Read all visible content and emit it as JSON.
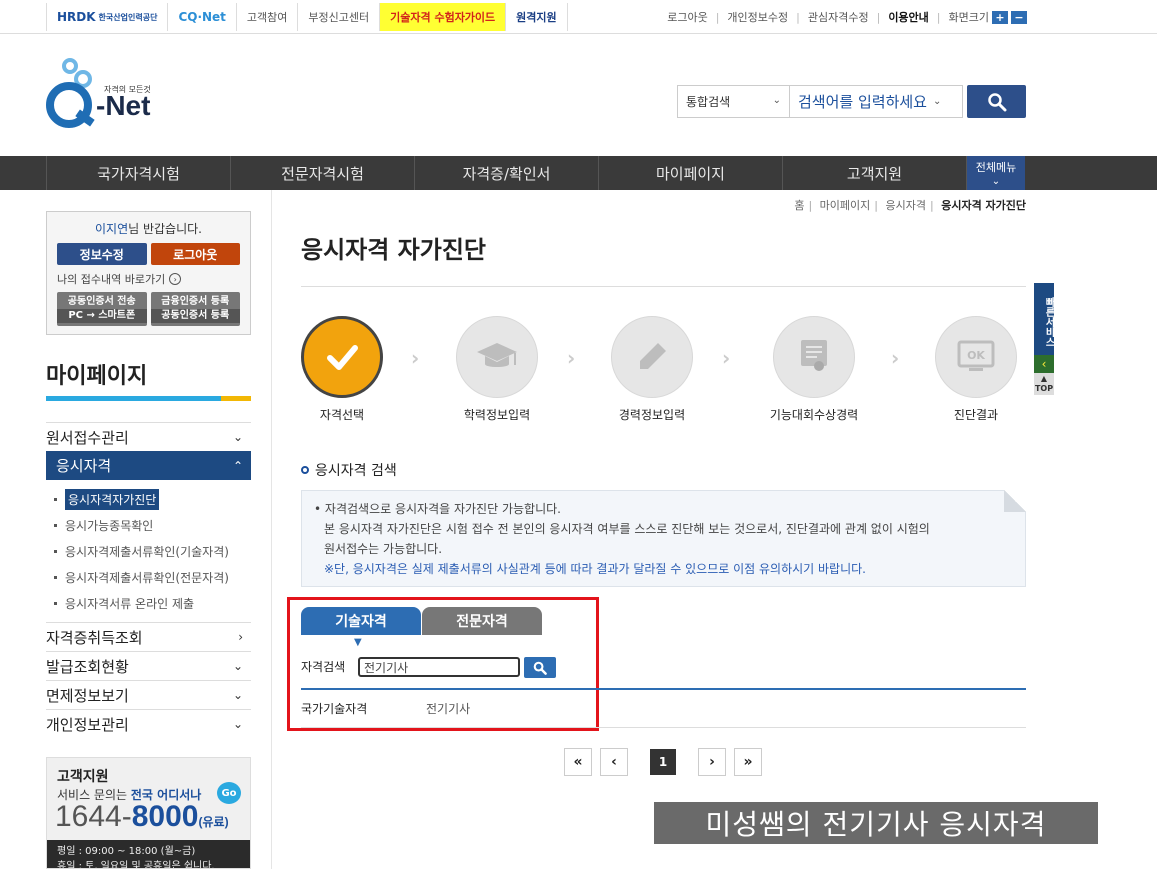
{
  "topbar": {
    "hrdk": "HRDK",
    "hrdk_sub": "한국산업인력공단",
    "cqnet": "CQ·Net",
    "participate": "고객참여",
    "report": "부정신고센터",
    "guide": "기술자격 수험자가이드",
    "remote": "원격지원",
    "logout": "로그아웃",
    "edit_info": "개인정보수정",
    "interest": "관심자격수정",
    "usage": "이용안내",
    "font_size": "화면크기",
    "plus": "+",
    "minus": "−"
  },
  "header": {
    "logo_text": "-Net",
    "slogan": "자격의 모든것",
    "search_type": "통합검색",
    "search_placeholder": "검색어를 입력하세요"
  },
  "gnb": {
    "items": [
      "국가자격시험",
      "전문자격시험",
      "자격증/확인서",
      "마이페이지",
      "고객지원"
    ],
    "all_menu": "전체메뉴"
  },
  "login": {
    "name": "이지연",
    "greeting": "님 반갑습니다.",
    "edit": "정보수정",
    "logout": "로그아웃",
    "shortcut": "나의 접수내역 바로가기",
    "cert1_top": "공동인증서 전송",
    "cert1_bottom": "PC → 스마트폰",
    "cert2_top": "금융인증서 등록",
    "cert2_bottom": "공동인증서 등록"
  },
  "sidebar": {
    "title": "마이페이지",
    "menus": [
      {
        "label": "원서접수관리"
      },
      {
        "label": "응시자격"
      },
      {
        "label": "자격증취득조회"
      },
      {
        "label": "발급조회현황"
      },
      {
        "label": "면제정보보기"
      },
      {
        "label": "개인정보관리"
      }
    ],
    "sub": [
      "응시자격자가진단",
      "응시가능종목확인",
      "응시자격제출서류확인(기술자격)",
      "응시자격제출서류확인(전문자격)",
      "응시자격서류 온라인 제출"
    ]
  },
  "cs": {
    "title": "고객지원",
    "line": "서비스 문의는",
    "line_b": "전국 어디서나",
    "go": "Go",
    "phone_a": "1644",
    "phone_dash": "-",
    "phone_b": "8000",
    "paid": "(유료)",
    "hours1": "평일 : 09:00 ~ 18:00 (월~금)",
    "hours2": "휴일 : 토, 일요일 및 공휴일은 쉽니다."
  },
  "breadcrumb": {
    "home": "홈",
    "mypage": "마이페이지",
    "qual": "응시자격",
    "current": "응시자격 자가진단"
  },
  "main": {
    "title": "응시자격 자가진단",
    "steps": [
      "자격선택",
      "학력정보입력",
      "경력정보입력",
      "기능대회수상경력",
      "진단결과"
    ],
    "section_title": "응시자격 검색",
    "notice1": "자격검색으로 응시자격을 자가진단 가능합니다.",
    "notice2": "본 응시자격 자가진단은 시험 접수 전 본인의 응시자격 여부를 스스로 진단해 보는 것으로서, 진단결과에 관계 없이 시험의",
    "notice3": "원서접수는 가능합니다.",
    "notice4": "※단, 응시자격은 실제 제출서류의 사실관계 등에 따라 결과가 달라질 수 있으므로 이점 유의하시기 바랍니다.",
    "tab_tech": "기술자격",
    "tab_pro": "전문자격",
    "search_label": "자격검색",
    "search_value": "전기기사",
    "result_cat": "국가기술자격",
    "result_name": "전기기사",
    "page": "1"
  },
  "quick": {
    "label": "빠른서비스",
    "top": "TOP"
  },
  "caption": "미성쌤의 전기기사 응시자격"
}
